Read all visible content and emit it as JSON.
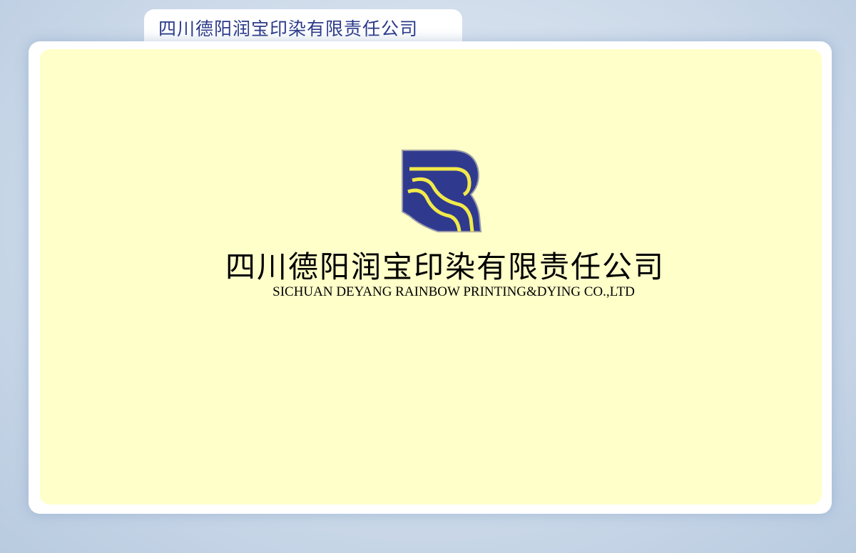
{
  "window": {
    "title": "四川德阳润宝印染有限责任公司"
  },
  "card": {
    "logo_icon": "rainbow-r-logo-icon",
    "company_name_cn": "四川德阳润宝印染有限责任公司",
    "company_name_en": "SICHUAN DEYANG RAINBOW PRINTING&DYING CO.,LTD"
  },
  "colors": {
    "panel_background": "#ffffca",
    "logo_blue": "#2f3a8f",
    "logo_yellow": "#f2ea4a",
    "title_text": "#2b3a8a"
  }
}
